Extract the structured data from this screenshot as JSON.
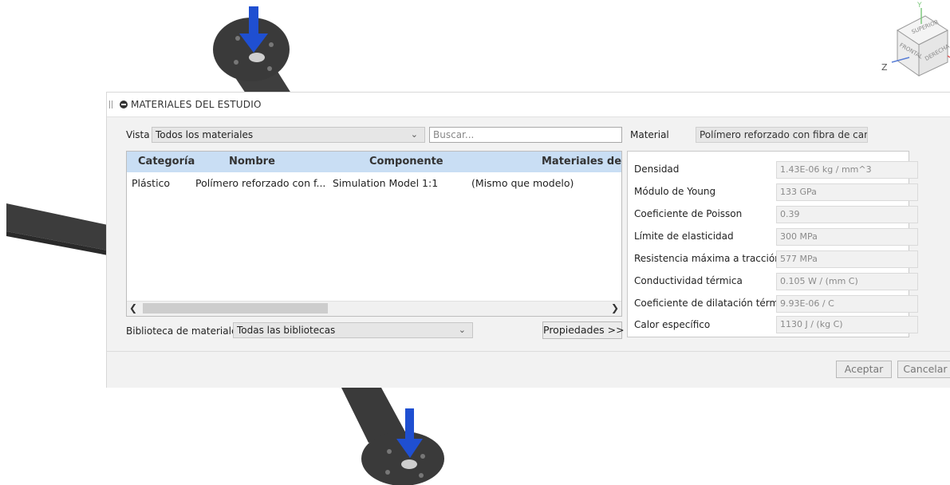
{
  "viewcube": {
    "face_top": "SUPERIOR",
    "face_front": "FRONTAL",
    "face_right": "DERECHA",
    "axis_z": "Z",
    "axis_y": "Y"
  },
  "dialog": {
    "title": "MATERIALES DEL ESTUDIO",
    "view_label": "Vista",
    "view_value": "Todos los materiales",
    "search_placeholder": "Buscar...",
    "material_label": "Material",
    "material_value": "Polímero reforzado con fibra de carbono",
    "table": {
      "columns": [
        "Categoría",
        "Nombre",
        "Componente",
        "Materiales de"
      ],
      "rows": [
        [
          "Plástico",
          "Polímero reforzado con f...",
          "Simulation Model 1:1",
          "(Mismo que modelo)"
        ]
      ]
    },
    "library_label": "Biblioteca de materiales",
    "library_value": "Todas las bibliotecas",
    "properties_button": "Propiedades >>",
    "properties": [
      {
        "label": "Densidad",
        "value": "1.43E-06 kg / mm^3"
      },
      {
        "label": "Módulo de Young",
        "value": "133 GPa"
      },
      {
        "label": "Coeficiente de Poisson",
        "value": "0.39"
      },
      {
        "label": "Límite de elasticidad",
        "value": "300 MPa"
      },
      {
        "label": "Resistencia máxima a tracción",
        "value": "577 MPa"
      },
      {
        "label": "Conductividad térmica",
        "value": "0.105 W / (mm C)"
      },
      {
        "label": "Coeficiente de dilatación térmica",
        "value": "9.93E-06 / C"
      },
      {
        "label": "Calor específico",
        "value": "1130 J / (kg C)"
      }
    ],
    "accept_button": "Aceptar",
    "cancel_button": "Cancelar"
  },
  "colors": {
    "header_blue": "#c9def4",
    "arrow_blue": "#1f4fd1",
    "part_dark": "#3a3a3a"
  }
}
